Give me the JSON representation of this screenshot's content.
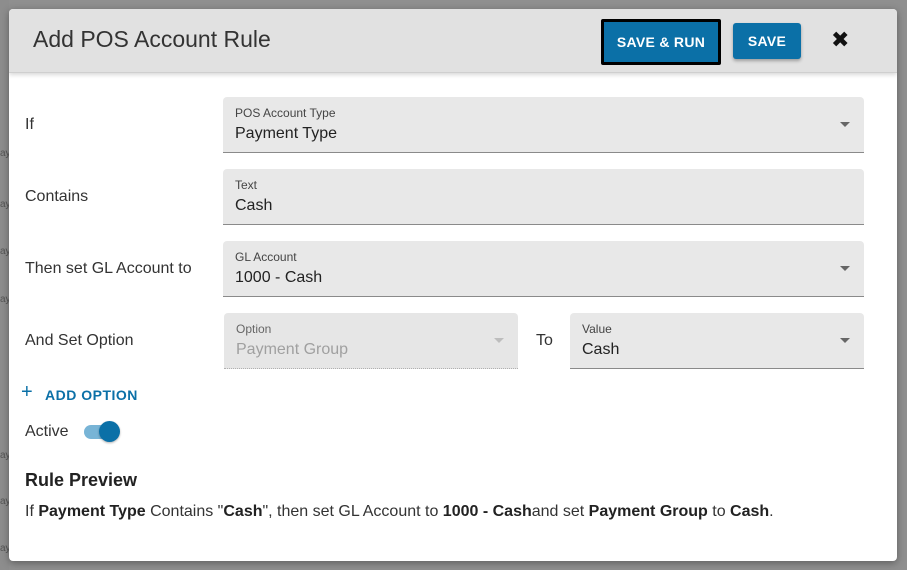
{
  "dialog": {
    "title": "Add POS Account Rule",
    "save_run_label": "SAVE & RUN",
    "save_label": "SAVE",
    "close_icon": "close-icon",
    "close_glyph": "✖"
  },
  "backdrop": {
    "fragments": [
      "ay",
      "ay",
      "ay",
      "ay",
      "ay",
      "ay",
      "ay"
    ]
  },
  "rows": {
    "if": {
      "label": "If",
      "field_label": "POS Account Type",
      "value": "Payment Type"
    },
    "contains": {
      "label": "Contains",
      "field_label": "Text",
      "value": "Cash"
    },
    "gl": {
      "label": "Then set GL Account to",
      "field_label": "GL Account",
      "value": "1000 - Cash"
    },
    "option": {
      "label": "And Set Option",
      "field_label": "Option",
      "value": "Payment Group",
      "to_label": "To",
      "value_field_label": "Value",
      "value_value": "Cash"
    }
  },
  "add_option": {
    "icon": "plus-icon",
    "glyph": "+",
    "label": "ADD OPTION"
  },
  "active": {
    "label": "Active",
    "on": true
  },
  "preview": {
    "heading": "Rule Preview",
    "p1": "If ",
    "b1": "Payment Type",
    "p2": " Contains \"",
    "b2": "Cash",
    "p3": "\", then set GL Account to ",
    "b3": "1000 - Cash",
    "p4": "and set ",
    "b4": "Payment Group",
    "p5": " to ",
    "b5": "Cash",
    "p6": "."
  },
  "colors": {
    "accent": "#0b70a7",
    "header_bg": "#e1e1e1",
    "field_bg": "#e8e8e8"
  }
}
